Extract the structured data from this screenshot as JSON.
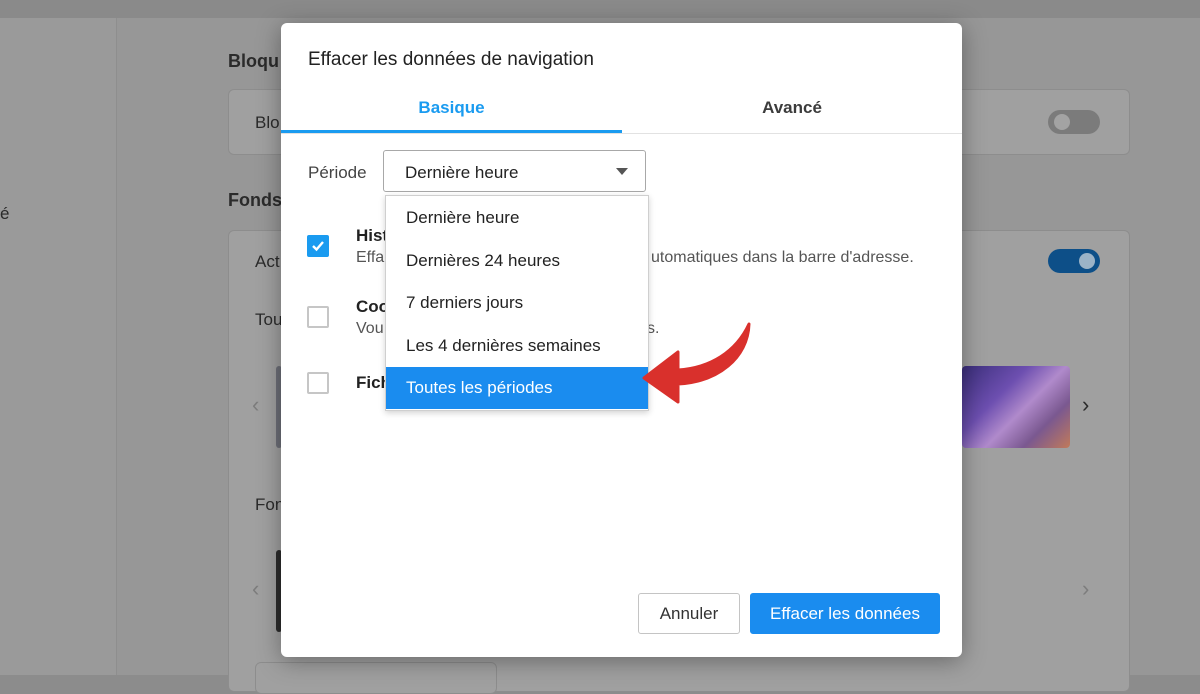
{
  "background": {
    "sidebar_fragment": "é",
    "section1_title": "Bloqu",
    "section1_row_label": "Blo",
    "section2_title": "Fonds",
    "section2_row_label": "Act",
    "section2_sub_label": "Tou",
    "section3_label": "Fon"
  },
  "dialog": {
    "title": "Effacer les données de navigation",
    "tabs": [
      {
        "label": "Basique",
        "active": true
      },
      {
        "label": "Avancé",
        "active": false
      }
    ],
    "period_label": "Période",
    "period_selected": "Dernière heure",
    "rows": [
      {
        "title": "Hist",
        "desc": "Effa",
        "desc_tail": "utomatiques dans la barre d'adresse.",
        "checked": true
      },
      {
        "title": "Coo",
        "desc": "Vou",
        "desc_tail": "s.",
        "checked": false
      },
      {
        "title": "Fich",
        "desc": "",
        "desc_tail": "",
        "checked": false
      }
    ],
    "options": [
      "Dernière heure",
      "Dernières 24 heures",
      "7 derniers jours",
      "Les 4 dernières semaines",
      "Toutes les périodes"
    ],
    "highlighted_option_index": 4,
    "cancel_label": "Annuler",
    "clear_label": "Effacer les données"
  },
  "colors": {
    "accent": "#1a9bf0",
    "highlight": "#1a8cef",
    "arrow": "#d9302c"
  }
}
